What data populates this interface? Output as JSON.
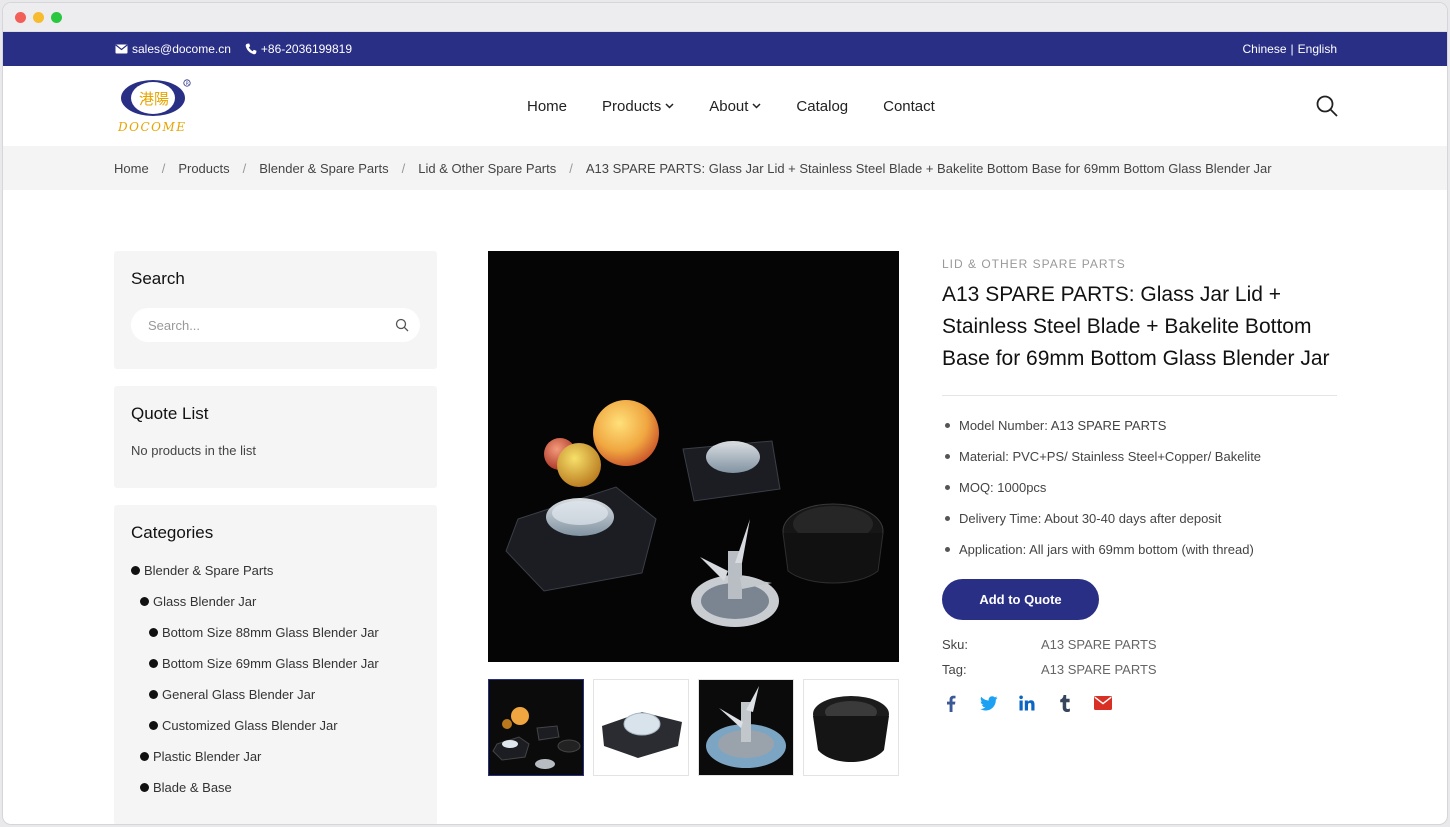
{
  "topbar": {
    "email": "sales@docome.cn",
    "phone": "+86-2036199819",
    "lang_chinese": "Chinese",
    "lang_sep": "|",
    "lang_english": "English"
  },
  "logo": {
    "text": "DOCOME",
    "chinese": "港陽"
  },
  "nav": {
    "home": "Home",
    "products": "Products",
    "about": "About",
    "catalog": "Catalog",
    "contact": "Contact"
  },
  "breadcrumb": {
    "items": [
      "Home",
      "Products",
      "Blender & Spare Parts",
      "Lid & Other Spare Parts",
      "A13 SPARE PARTS: Glass Jar Lid + Stainless Steel Blade + Bakelite Bottom Base for 69mm Bottom Glass Blender Jar"
    ],
    "sep": "/"
  },
  "sidebar": {
    "search_title": "Search",
    "search_placeholder": "Search...",
    "quote_title": "Quote List",
    "quote_empty": "No products in the list",
    "categories_title": "Categories",
    "categories": [
      "Blender & Spare Parts",
      "Glass Blender Jar",
      "Bottom Size 88mm Glass Blender Jar",
      "Bottom Size 69mm Glass Blender Jar",
      "General Glass Blender Jar",
      "Customized Glass Blender Jar",
      "Plastic Blender Jar",
      "Blade & Base"
    ]
  },
  "product": {
    "category": "LID & OTHER SPARE PARTS",
    "title": "A13 SPARE PARTS: Glass Jar Lid + Stainless Steel Blade + Bakelite Bottom Base for 69mm Bottom Glass Blender Jar",
    "specs": [
      "Model Number: A13 SPARE PARTS",
      "Material: PVC+PS/ Stainless Steel+Copper/ Bakelite",
      "MOQ: 1000pcs",
      "Delivery Time: About 30-40 days after deposit",
      "Application: All jars with 69mm bottom (with thread)"
    ],
    "add_to_quote": "Add to Quote",
    "sku_label": "Sku:",
    "sku_value": "A13 SPARE PARTS",
    "tag_label": "Tag:",
    "tag_value": "A13 SPARE PARTS"
  },
  "colors": {
    "brand": "#2a2f86",
    "facebook": "#3b5998",
    "twitter": "#1da1f2",
    "linkedin": "#0a66c2",
    "tumblr": "#35465c",
    "email": "#d93025"
  },
  "share_icons": [
    "facebook-icon",
    "twitter-icon",
    "linkedin-icon",
    "tumblr-icon",
    "email-icon"
  ]
}
